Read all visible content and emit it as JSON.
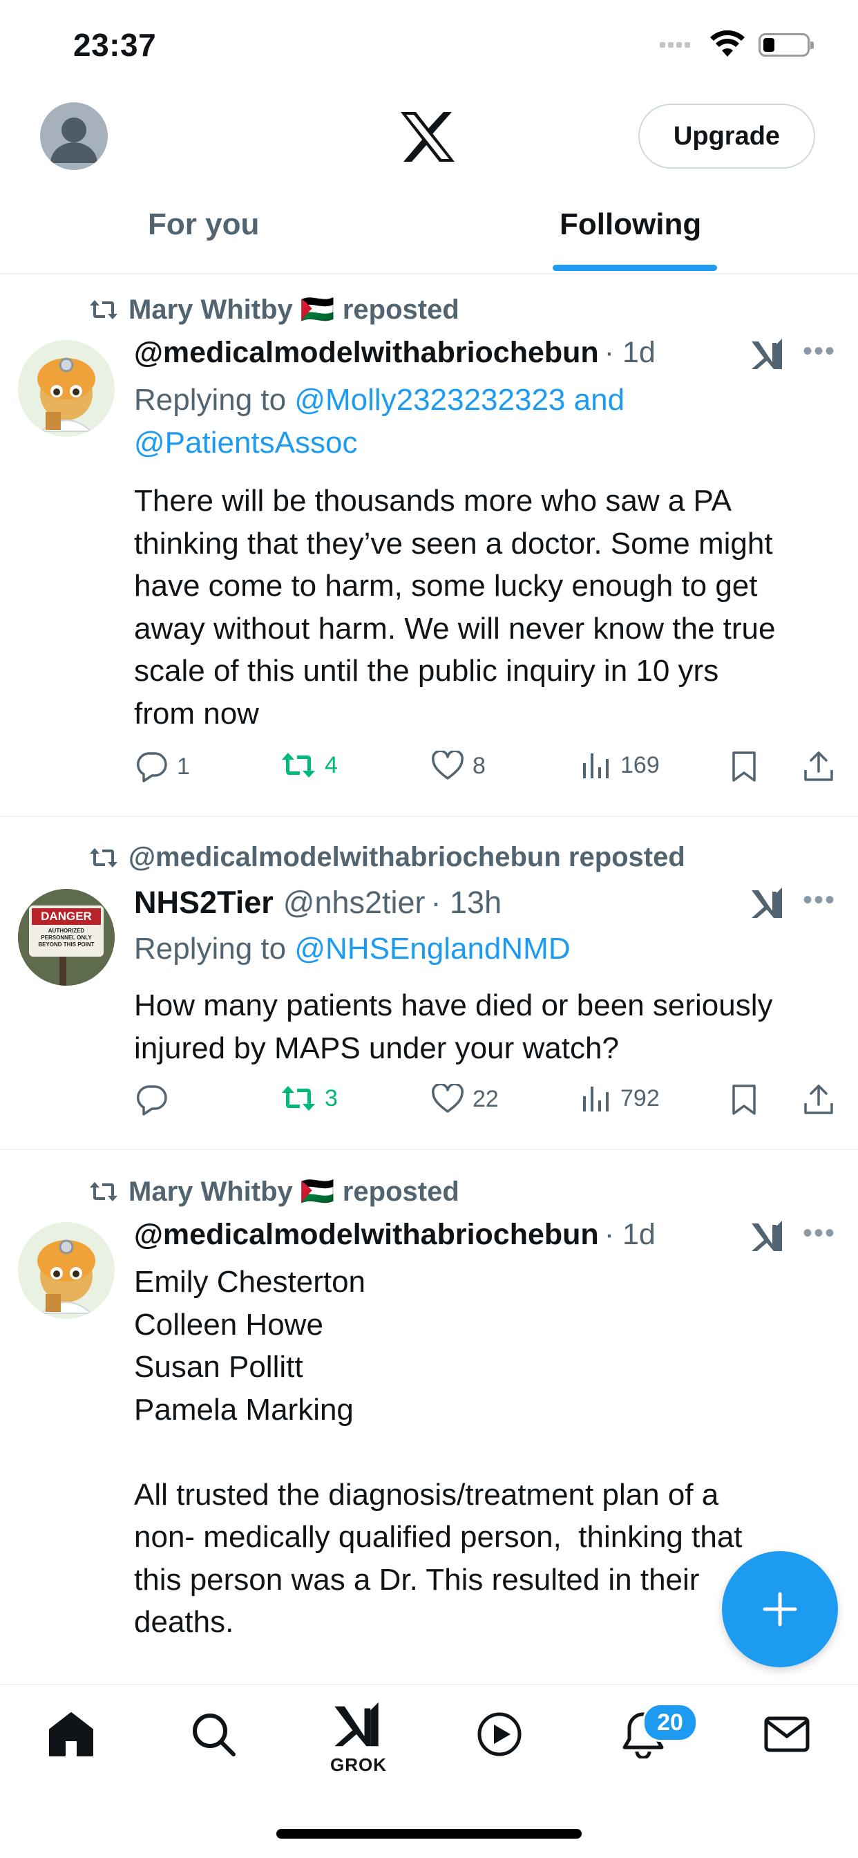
{
  "status_bar": {
    "time": "23:37"
  },
  "header": {
    "upgrade_label": "Upgrade"
  },
  "tabs": [
    {
      "label": "For you"
    },
    {
      "label": "Following"
    }
  ],
  "posts": [
    {
      "repost_by": "Mary Whitby 🇵🇸 reposted",
      "name": "@medicalmodelwithabriochebun",
      "handle": "",
      "time": "· 1d",
      "reply_prefix": "Replying to ",
      "reply_mentions_line1": "@Molly2323232323 and",
      "reply_mentions_line2": "@PatientsAssoc",
      "text": "There will be thousands more who saw a PA\nthinking that they’ve seen a doctor. Some might\nhave come to harm, some lucky enough to get\naway without harm. We will never know the true\nscale of this until the public inquiry in 10 yrs\nfrom now",
      "replies": "1",
      "reposts": "4",
      "likes": "8",
      "views": "169"
    },
    {
      "repost_by": "@medicalmodelwithabriochebun reposted",
      "name": "NHS2Tier",
      "handle": "@nhs2tier",
      "time": "· 13h",
      "reply_prefix": "Replying to ",
      "reply_mentions_line1": "@NHSEnglandNMD",
      "avatar_sign_text": "DANGER",
      "avatar_sign_sub": "AUTHORIZED PERSONNEL ONLY BEYOND THIS POINT",
      "text": "How many patients have died or been seriously\ninjured by MAPS under your watch?",
      "replies": "",
      "reposts": "3",
      "likes": "22",
      "views": "792"
    },
    {
      "repost_by": "Mary Whitby 🇵🇸 reposted",
      "name": "@medicalmodelwithabriochebun",
      "time": "· 1d",
      "text": "Emily Chesterton\nColleen Howe\nSusan Pollitt\nPamela Marking\n\nAll trusted the diagnosis/treatment plan of a\nnon- medically qualified person,  thinking that\nthis person was a Dr. This resulted in their\ndeaths."
    }
  ],
  "nav": {
    "grok_label": "GROK",
    "notifications_count": "20"
  },
  "colors": {
    "accent": "#1d9bf0",
    "repost_green": "#00ba7c",
    "secondary_text": "#536471"
  },
  "icons": [
    "home-icon",
    "search-icon",
    "grok-icon",
    "video-icon",
    "bell-icon",
    "mail-icon",
    "compose-plus-icon",
    "reply-icon",
    "repost-icon",
    "like-icon",
    "views-icon",
    "bookmark-icon",
    "share-icon",
    "more-icon"
  ]
}
